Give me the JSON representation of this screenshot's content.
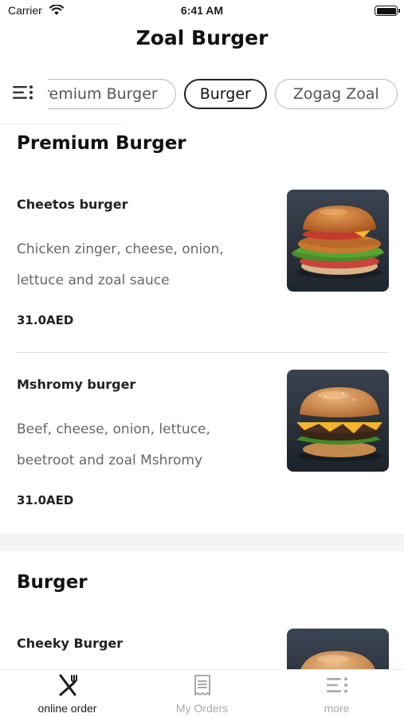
{
  "status_bar": {
    "carrier": "Carrier",
    "time": "6:41 AM"
  },
  "header": {
    "title": "Zoal Burger"
  },
  "categories": [
    {
      "label": "Premium Burger",
      "active": false
    },
    {
      "label": "Burger",
      "active": true
    },
    {
      "label": "Zogag Zoal",
      "active": false
    }
  ],
  "sections": [
    {
      "title": "Premium Burger",
      "items": [
        {
          "name": "Cheetos burger",
          "description": "Chicken zinger, cheese, onion, lettuce and zoal sauce",
          "price": "31.0AED",
          "image_icon": "chicken-burger-photo"
        },
        {
          "name": "Mshromy burger",
          "description": "Beef, cheese, onion, lettuce, beetroot and zoal Mshromy",
          "price": "31.0AED",
          "image_icon": "beef-burger-photo"
        }
      ]
    },
    {
      "title": "Burger",
      "items": [
        {
          "name": "Cheeky Burger",
          "description": "",
          "price": "",
          "image_icon": "burger-photo"
        }
      ]
    }
  ],
  "tab_bar": {
    "items": [
      {
        "label": "online order",
        "icon": "fork-knife-icon",
        "active": true
      },
      {
        "label": "My Orders",
        "icon": "receipt-icon",
        "active": false
      },
      {
        "label": "more",
        "icon": "menu-list-icon",
        "active": false
      }
    ]
  },
  "colors": {
    "active": "#1c1c1e",
    "inactive": "#a9a9a9",
    "divider": "#dedede",
    "section_band": "#f4f4f4"
  }
}
